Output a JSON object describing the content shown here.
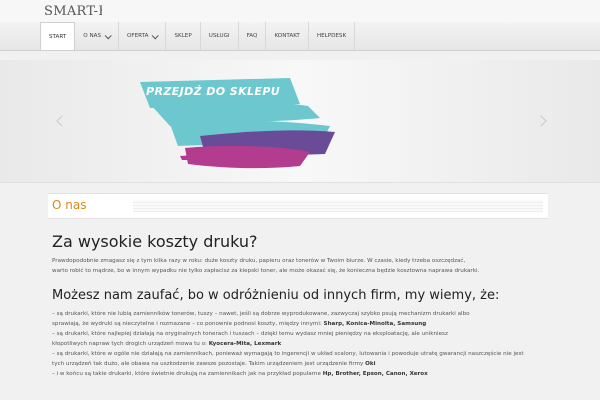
{
  "header": {
    "logo_text": "SMART-K"
  },
  "nav": {
    "items": [
      {
        "label": "START",
        "active": true,
        "dropdown": false
      },
      {
        "label": "O nas",
        "active": false,
        "dropdown": true
      },
      {
        "label": "OFERTA",
        "active": false,
        "dropdown": true
      },
      {
        "label": "SKLEP",
        "active": false,
        "dropdown": false
      },
      {
        "label": "USŁUGI",
        "active": false,
        "dropdown": false
      },
      {
        "label": "FAQ",
        "active": false,
        "dropdown": false
      },
      {
        "label": "KONTAKT",
        "active": false,
        "dropdown": false
      },
      {
        "label": "HELPDESK",
        "active": false,
        "dropdown": false
      }
    ]
  },
  "slider": {
    "banner_text": "PRZEJDŹ DO SKLEPU",
    "colors": {
      "cyan": "#6cc7cf",
      "purple": "#6a4b98",
      "magenta": "#b43c8e"
    }
  },
  "section": {
    "title": "O nas"
  },
  "article": {
    "heading1": "Za wysokie koszty druku?",
    "para1_line1": "Prawdopodobnie zmagasz się z tym kilka razy w roku: duże koszty druku, papieru oraz tonerów w Twoim biurze. W czasie, kiedy trzeba oszczędzać,",
    "para1_line2": "warto robić to mądrze, bo w innym wypadku nie tylko zapłacisz za kiepski toner, ale może okazać się, że konieczna będzie kosztowna naprawa drukarki.",
    "heading2": "Możesz nam zaufać, bo w odróżnieniu od innych firm, my wiemy, że:",
    "list_lines": [
      "– są drukarki, które nie lubią zamienników tonerów, tuszy – nawet, jeśli są dobrze wyprodukowane, zazwyczaj szybko psują mechanizm drukarki albo",
      "sprawiają, że wydruki są nieczytelne i rozmazane – co ponownie podnosi koszty, między innymi: ",
      "– są drukarki, które najlepiej działają na oryginalnych tonerach i tuszach – dzięki temu wydasz mniej pieniędzy na eksploatację, ale unikniesz",
      "kłopotliwych napraw tych drogich urządzeń mowa tu o: ",
      "– są drukarki, które w ogóle nie działają na zamiennikach, ponieważ wymagają to ingerencji w układ scalony, lutowania i powoduje utratę gwarancji naszczęście nie jest",
      "tych urządzeń tak dużo, ale obawa na uszkodzenie zawsze pozostaje. Takim urządzeniem jest urządzenie firmy ",
      "– i w końcu są takie drukarki, które świetnie drukują na zamiennikach jak na przykład popularne "
    ],
    "brands_line2": "Sharp, Konica-Minolta, Samsung",
    "brands_line4": "Kyocera-Mita, Lexmark",
    "brands_line6": "Oki",
    "brands_line7": "Hp, Brother, Epson, Canon, Xerox"
  }
}
